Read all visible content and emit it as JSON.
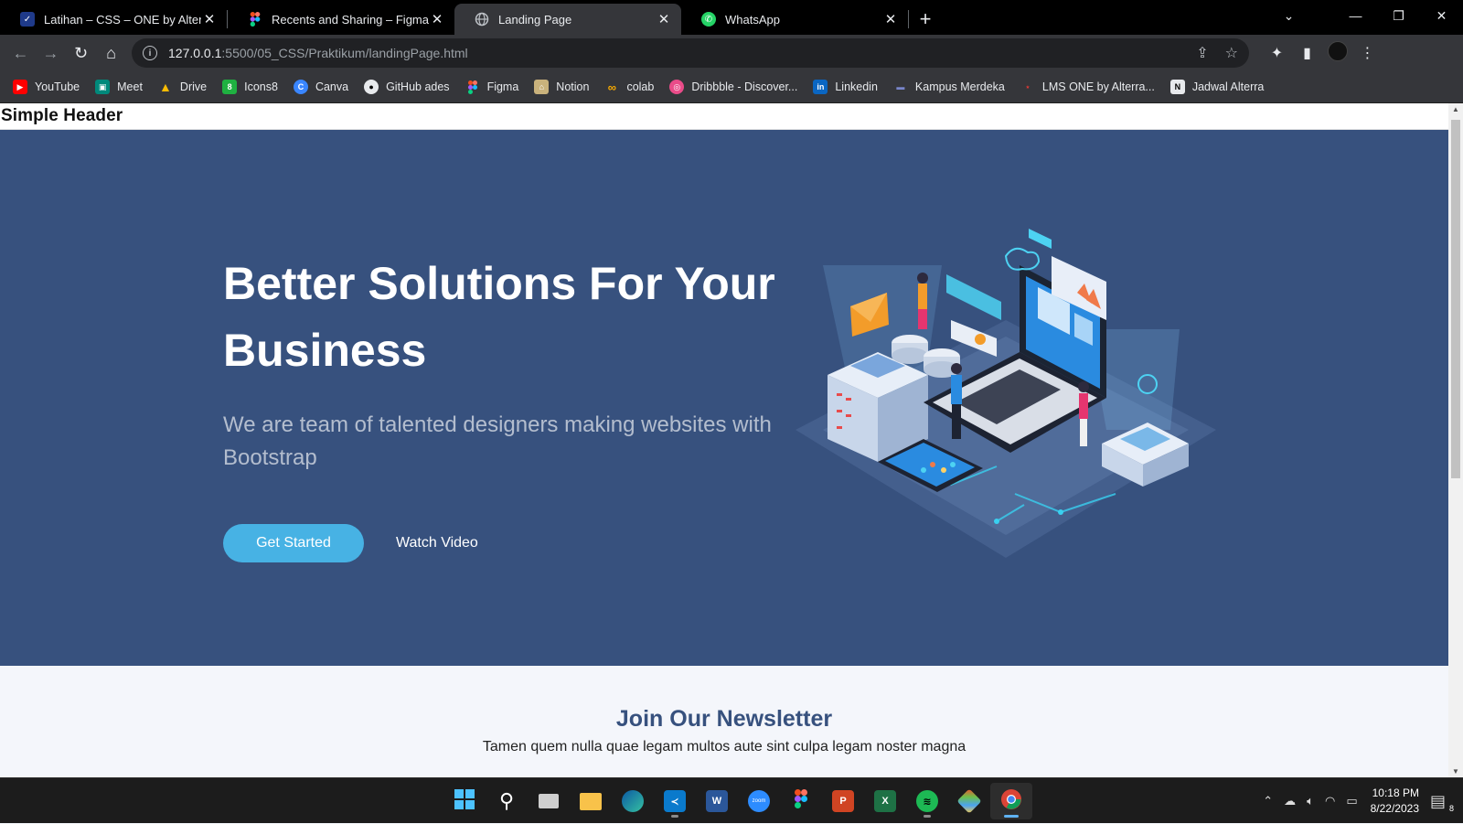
{
  "browser": {
    "tabs": [
      {
        "title": "Latihan – CSS – ONE by Alterra Academy",
        "icon": "alterra-favicon",
        "active": false
      },
      {
        "title": "Recents and Sharing – Figma",
        "icon": "figma-favicon",
        "active": false
      },
      {
        "title": "Landing Page",
        "icon": "globe-favicon",
        "active": true
      },
      {
        "title": "WhatsApp",
        "icon": "whatsapp-favicon",
        "active": false
      }
    ],
    "address": {
      "host": "127.0.0.1",
      "path": ":5500/05_CSS/Praktikum/landingPage.html"
    },
    "bookmarks": [
      {
        "label": "YouTube",
        "color": "#ff0000"
      },
      {
        "label": "Meet",
        "color": "#00897b"
      },
      {
        "label": "Drive",
        "color": "#1fa463"
      },
      {
        "label": "Icons8",
        "color": "#1fb141"
      },
      {
        "label": "Canva",
        "color": "#3a86ff"
      },
      {
        "label": "GitHub ades",
        "color": "#e8eaed"
      },
      {
        "label": "Figma",
        "color": "#f24e1e"
      },
      {
        "label": "Notion",
        "color": "#c9b27c"
      },
      {
        "label": "colab",
        "color": "#f9ab00"
      },
      {
        "label": "Dribbble - Discover...",
        "color": "#ea4c89"
      },
      {
        "label": "Linkedin",
        "color": "#0a66c2"
      },
      {
        "label": "Kampus Merdeka",
        "color": "#3f51b5"
      },
      {
        "label": "LMS ONE by Alterra...",
        "color": "#e53935"
      },
      {
        "label": "Jadwal Alterra",
        "color": "#e8eaed"
      }
    ]
  },
  "page": {
    "header_title": "Simple Header",
    "hero": {
      "title": "Better Solutions For Your Business",
      "subtitle": "We are team of talented designers making websites with Bootstrap",
      "primary_button": "Get Started",
      "secondary_button": "Watch Video"
    },
    "newsletter": {
      "title": "Join Our Newsletter",
      "text": "Tamen quem nulla quae legam multos aute sint culpa legam noster magna"
    }
  },
  "taskbar": {
    "time": "10:18 PM",
    "date": "8/22/2023",
    "notification_count": "8",
    "apps": [
      {
        "name": "start",
        "label": ""
      },
      {
        "name": "search",
        "label": ""
      },
      {
        "name": "task-view",
        "label": ""
      },
      {
        "name": "file-explorer",
        "label": ""
      },
      {
        "name": "edge",
        "label": ""
      },
      {
        "name": "vscode",
        "label": ""
      },
      {
        "name": "word",
        "label": "W"
      },
      {
        "name": "zoom",
        "label": "zoom"
      },
      {
        "name": "figma",
        "label": ""
      },
      {
        "name": "powerpoint",
        "label": "P"
      },
      {
        "name": "excel",
        "label": "X"
      },
      {
        "name": "spotify",
        "label": ""
      },
      {
        "name": "git",
        "label": ""
      },
      {
        "name": "chrome",
        "label": ""
      }
    ]
  },
  "colors": {
    "hero_bg": "#37517e",
    "accent": "#47b2e4",
    "heading": "#37517e"
  }
}
